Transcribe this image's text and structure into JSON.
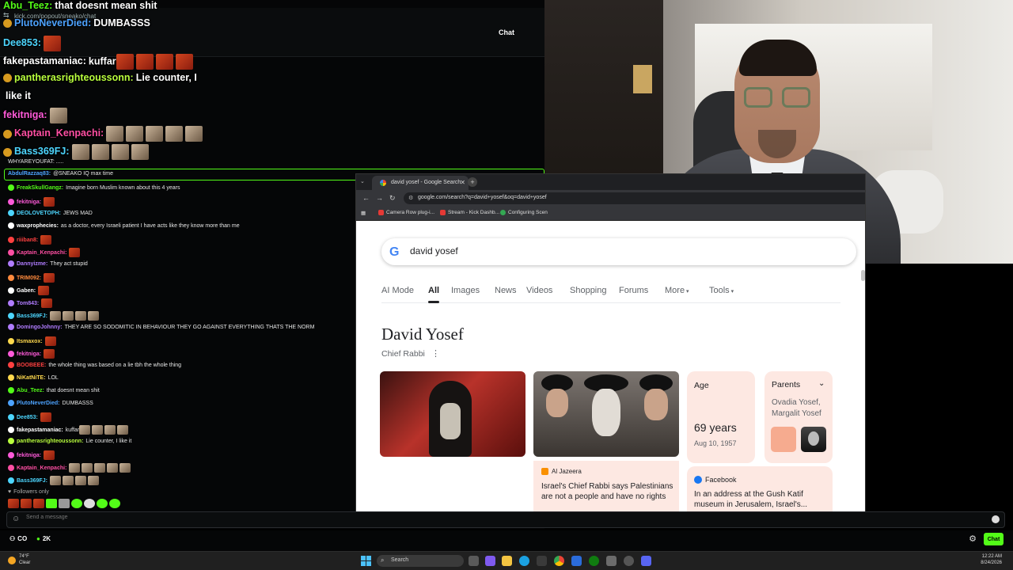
{
  "chat": {
    "header_url": "kick.com/popout/sneako/chat",
    "header_title": "Chat",
    "big_messages": [
      {
        "user": "Abu_Teez:",
        "color": "#53fc18",
        "text": "that doesnt mean shit"
      },
      {
        "user": "PlutoNeverDied:",
        "color": "#4da3ff",
        "text": "DUMBASSS"
      },
      {
        "user": "Dee853:",
        "color": "#4dd6ff",
        "text": ""
      },
      {
        "user": "fakepastamaniac:",
        "color": "#ffffff",
        "text": "kuffar"
      },
      {
        "user": "pantherasrighteoussonn:",
        "color": "#b9ff3d",
        "text": "Lie counter, I"
      },
      {
        "user": "",
        "color": "#ffffff",
        "text": "like it"
      },
      {
        "user": "fekitniga:",
        "color": "#ff5ad9",
        "text": ""
      },
      {
        "user": "Kaptain_Kenpachi:",
        "color": "#ff4fa3",
        "text": ""
      },
      {
        "user": "Bass369FJ:",
        "color": "#4dd6ff",
        "text": ""
      }
    ],
    "pinned_text": "WHYAREYOUFAT: .....",
    "pinned_highlight": {
      "user": "AbdulRazzaq83:",
      "text": "@SNEAKO IQ max time"
    },
    "small_messages": [
      {
        "user": "FreakSkullGangz:",
        "color": "#53fc18",
        "text": "Imagine born Muslim known about this 4 years"
      },
      {
        "user": "fekitniga:",
        "color": "#ff5ad9",
        "text": ""
      },
      {
        "user": "DEOLOVETOPH:",
        "color": "#4dd6ff",
        "text": "JEWS MAD"
      },
      {
        "user": "waxprophecies:",
        "color": "#ffffff",
        "text": "as a doctor, every Israeli patient I have acts like they know more than me"
      },
      {
        "user": "riiiban8:",
        "color": "#ff4040",
        "text": ""
      },
      {
        "user": "Kaptain_Kenpachi:",
        "color": "#ff4fa3",
        "text": ""
      },
      {
        "user": "Dannyizme:",
        "color": "#b07cff",
        "text": "They act stupid"
      },
      {
        "user": "TRIM092:",
        "color": "#ff8a3d",
        "text": ""
      },
      {
        "user": "Gaben:",
        "color": "#ffffff",
        "text": ""
      },
      {
        "user": "Tom843:",
        "color": "#b07cff",
        "text": ""
      },
      {
        "user": "Bass369FJ:",
        "color": "#4dd6ff",
        "text": ""
      },
      {
        "user": "DomingoJohnny:",
        "color": "#b07cff",
        "text": "THEY ARE SO SODOMITIC IN BEHAVIOUR THEY GO AGAINST EVERYTHING THATS THE NORM"
      },
      {
        "user": "Itsmaxox:",
        "color": "#ffd94d",
        "text": ""
      },
      {
        "user": "fekitniga:",
        "color": "#ff5ad9",
        "text": ""
      },
      {
        "user": "BOOBEEE:",
        "color": "#ff4040",
        "text": "the whole thing was based on a lie tbh the whole thing"
      },
      {
        "user": "NiKatNiTE:",
        "color": "#ffd94d",
        "text": "LOL"
      },
      {
        "user": "Abu_Teez:",
        "color": "#53fc18",
        "text": "that doesnt mean shit"
      },
      {
        "user": "PlutoNeverDied:",
        "color": "#4da3ff",
        "text": "DUMBASSS"
      },
      {
        "user": "Dee853:",
        "color": "#4dd6ff",
        "text": ""
      },
      {
        "user": "fakepastamaniac:",
        "color": "#ffffff",
        "text": "kuffar"
      },
      {
        "user": "pantherasrighteoussonn:",
        "color": "#b9ff3d",
        "text": "Lie counter, I like it"
      },
      {
        "user": "fekitniga:",
        "color": "#ff5ad9",
        "text": ""
      },
      {
        "user": "Kaptain_Kenpachi:",
        "color": "#ff4fa3",
        "text": ""
      },
      {
        "user": "Bass369FJ:",
        "color": "#4dd6ff",
        "text": ""
      }
    ],
    "followers_only": "Followers only",
    "input_placeholder": "Send a message",
    "viewer_count_a": "CO",
    "viewer_count_b": "2K",
    "chat_button": "Chat"
  },
  "browser": {
    "tab_title": "david yosef - Google Search",
    "url": "google.com/search?q=david+yosef&oq=david+yosef",
    "bookmarks": [
      "Camera Row plug-i...",
      "Stream - Kick Dashb...",
      "Configuring Scen"
    ],
    "search_query": "david yosef",
    "tabs": [
      "AI Mode",
      "All",
      "Images",
      "News",
      "Videos",
      "Shopping",
      "Forums",
      "More",
      "Tools"
    ],
    "active_tab": "All",
    "panel_title": "David Yosef",
    "panel_subtitle": "Chief Rabbi",
    "age_label": "Age",
    "age_value": "69 years",
    "birth_date": "Aug 10, 1957",
    "parents_label": "Parents",
    "parents_names": "Ovadia Yosef, Margalit Yosef",
    "news_source": "Al Jazeera",
    "news_headline": "Israel's Chief Rabbi says Palestinians are not a people and have no rights",
    "fb_source": "Facebook",
    "fb_text": "In an address at the Gush Katif museum in Jerusalem, Israel's..."
  },
  "taskbar": {
    "weather_temp": "74°F",
    "weather_desc": "Clear",
    "search_label": "Search",
    "time": "12:22 AM",
    "date": "8/24/2026"
  }
}
